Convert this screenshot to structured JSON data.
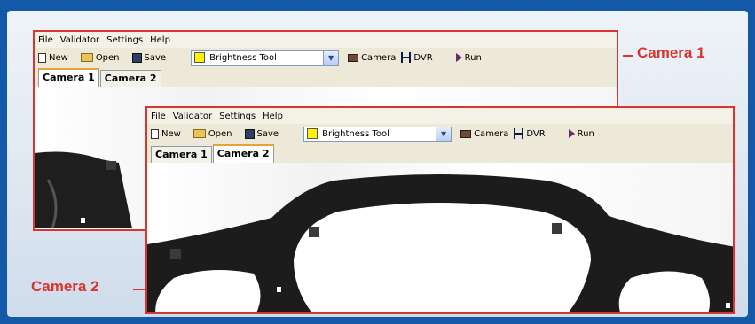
{
  "menu": [
    "File",
    "Validator",
    "Settings",
    "Help"
  ],
  "toolbar": {
    "new_label": "New",
    "open_label": "Open",
    "save_label": "Save",
    "tool_selected": "Brightness Tool",
    "camera_label": "Camera",
    "dvr_label": "DVR",
    "run_label": "Run"
  },
  "tabs": [
    "Camera 1",
    "Camera 2"
  ],
  "window1": {
    "active_tab": "Camera 1"
  },
  "window2": {
    "active_tab": "Camera 2"
  },
  "callouts": {
    "camera1": "Camera 1",
    "camera2": "Camera 2"
  },
  "colors": {
    "background": "#1458a8",
    "accent": "#d9352f",
    "tool_swatch": "#fff200",
    "tab_highlight": "#e7a436"
  },
  "icons": [
    "new-icon",
    "open-folder-icon",
    "save-icon",
    "camera-icon",
    "dvr-icon",
    "run-icon",
    "dropdown-arrow-icon"
  ]
}
